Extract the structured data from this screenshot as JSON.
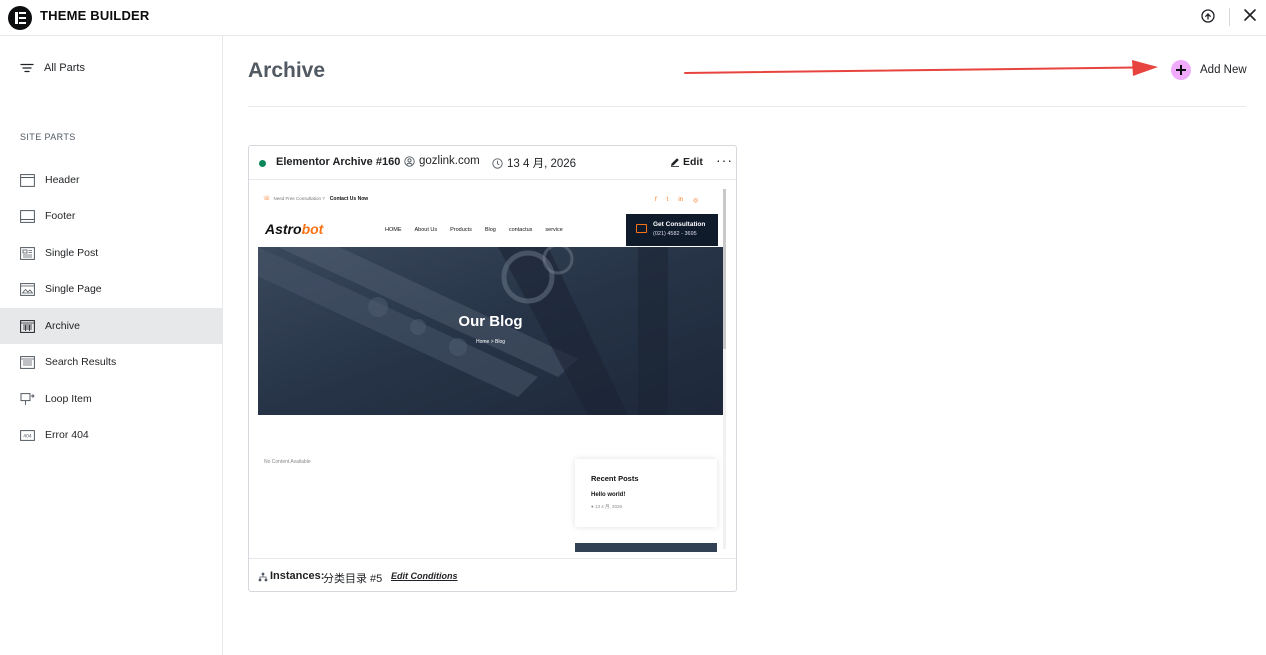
{
  "app": {
    "title": "THEME BUILDER"
  },
  "sidebar": {
    "all_parts_label": "All Parts",
    "section_title": "SITE PARTS",
    "items": [
      {
        "label": "Header",
        "icon": "header-layout-icon"
      },
      {
        "label": "Footer",
        "icon": "footer-layout-icon"
      },
      {
        "label": "Single Post",
        "icon": "single-post-icon"
      },
      {
        "label": "Single Page",
        "icon": "single-page-icon"
      },
      {
        "label": "Archive",
        "icon": "archive-grid-icon",
        "active": true
      },
      {
        "label": "Search Results",
        "icon": "search-results-icon"
      },
      {
        "label": "Loop Item",
        "icon": "loop-item-icon"
      },
      {
        "label": "Error 404",
        "icon": "error-404-icon"
      }
    ]
  },
  "main": {
    "title": "Archive",
    "add_new_label": "Add New"
  },
  "card": {
    "name": "Elementor Archive #160",
    "author": "gozlink.com",
    "date": "13 4 月, 2026",
    "edit_label": "Edit",
    "more_label": "···",
    "status_color": "#0a875a",
    "instances_label": "Instances:",
    "instances_value": "分类目录 #5",
    "edit_conditions_label": "Edit Conditions"
  },
  "preview": {
    "consult_prompt": "Need Free Consultation ?",
    "contact_link": "Contact Us Now",
    "social": [
      "f",
      "t",
      "in",
      "◎"
    ],
    "logo_main": "Astro",
    "logo_accent": "bot",
    "nav": [
      "HOME",
      "About Us",
      "Products",
      "Blog",
      "contactus",
      "service"
    ],
    "cta_title": "Get Consultation",
    "cta_phone": "(021) 4582 - 3695",
    "hero_title": "Our Blog",
    "hero_breadcrumb": "Home  >  Blog",
    "no_content": "No Content Available",
    "recent_title": "Recent Posts",
    "recent_post": "Hello world!",
    "recent_date": "● 13 4 月, 2026",
    "accent_color": "#f97316"
  }
}
